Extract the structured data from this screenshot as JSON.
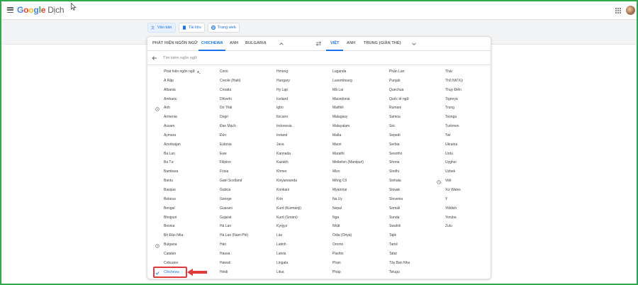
{
  "app": {
    "logo_parts": [
      "G",
      "o",
      "o",
      "g",
      "l",
      "e"
    ],
    "product": "Dịch"
  },
  "modes": [
    {
      "label": "Văn bản",
      "icon": "translate-icon",
      "active": true
    },
    {
      "label": "Tài liệu",
      "icon": "document-icon",
      "active": false
    },
    {
      "label": "Trang web",
      "icon": "globe-icon",
      "active": false
    }
  ],
  "source_tabs": [
    {
      "label": "PHÁT HIỆN NGÔN NGỮ",
      "active": false
    },
    {
      "label": "CHICHEWA",
      "active": true
    },
    {
      "label": "ANH",
      "active": false
    },
    {
      "label": "BULGARIA",
      "active": false
    }
  ],
  "target_tabs": [
    {
      "label": "VIỆT",
      "active": true
    },
    {
      "label": "ANH",
      "active": false
    },
    {
      "label": "TRUNG (GIẢN THỂ)",
      "active": false
    }
  ],
  "search": {
    "placeholder": "Tìm kiếm ngôn ngữ",
    "value": ""
  },
  "columns": [
    [
      "Phát hiện ngôn ngữ",
      "Á Rập",
      "Albania",
      "Amharic",
      "Anh",
      "Armenia",
      "Assam",
      "Aymara",
      "Azerbaijan",
      "Ba Lan",
      "Ba Tư",
      "Bambara",
      "Bantu",
      "Basque",
      "Belarus",
      "Bengal",
      "Bhojpuri",
      "Bosnia",
      "Bồ Đào Nha",
      "Bulgaria",
      "Catalan",
      "Cebuano",
      "Chichewa"
    ],
    [
      "Corsi",
      "Creole (Haiti)",
      "Croatia",
      "Dhivehi",
      "Do Thái",
      "Dogri",
      "Đan Mạch",
      "Đức",
      "Estonia",
      "Ewe",
      "Filipino",
      "Frisia",
      "Gael Scotland",
      "Galicia",
      "George",
      "Guarani",
      "Gujarat",
      "Hà Lan",
      "Hà Lan (Nam Phi)",
      "Hàn",
      "Hausa",
      "Hawaii",
      "Hindi"
    ],
    [
      "Hmong",
      "Hungary",
      "Hy Lạp",
      "Iceland",
      "Igbo",
      "Ilocano",
      "Indonesia",
      "Ireland",
      "Java",
      "Kannada",
      "Kazakh",
      "Khmer",
      "Kinyarwanda",
      "Konkani",
      "Krio",
      "Kurd (Kurmanji)",
      "Kurd (Sorani)",
      "Kyrgyz",
      "Lào",
      "Latinh",
      "Latvia",
      "Lingala",
      "Litva"
    ],
    [
      "Luganda",
      "Luxembourg",
      "Mã Lai",
      "Macedonia",
      "Maithili",
      "Malagasy",
      "Malayalam",
      "Malta",
      "Maori",
      "Marathi",
      "Meiteilon (Manipuri)",
      "Mizo",
      "Mông Cổ",
      "Myanmar",
      "Na Uy",
      "Nepal",
      "Nga",
      "Nhật",
      "Odia (Oriya)",
      "Oromo",
      "Pashto",
      "Phạn",
      "Pháp"
    ],
    [
      "Phần Lan",
      "Punjab",
      "Quechua",
      "Quốc tế ngữ",
      "Rumani",
      "Samoa",
      "Séc",
      "Sepedi",
      "Serbia",
      "Sesotho",
      "Shona",
      "Sindhi",
      "Sinhala",
      "Slovak",
      "Slovenia",
      "Somali",
      "Sunda",
      "Swahili",
      "Tajik",
      "Tamil",
      "Tatar",
      "Tây Ban Nha",
      "Telugu"
    ],
    [
      "Thái",
      "Thổ Nhĩ Kỳ",
      "Thụy Điển",
      "Tigrinya",
      "Trung",
      "Tsonga",
      "Turkmen",
      "Twi",
      "Ukraina",
      "Urdu",
      "Uyghur",
      "Uzbek",
      "Việt",
      "Xứ Wales",
      "Ý",
      "Yiddish",
      "Yoruba",
      "Zulu"
    ]
  ],
  "history_items": [
    "Anh",
    "Bulgaria",
    "Việt"
  ],
  "selected_item": "Chichewa"
}
